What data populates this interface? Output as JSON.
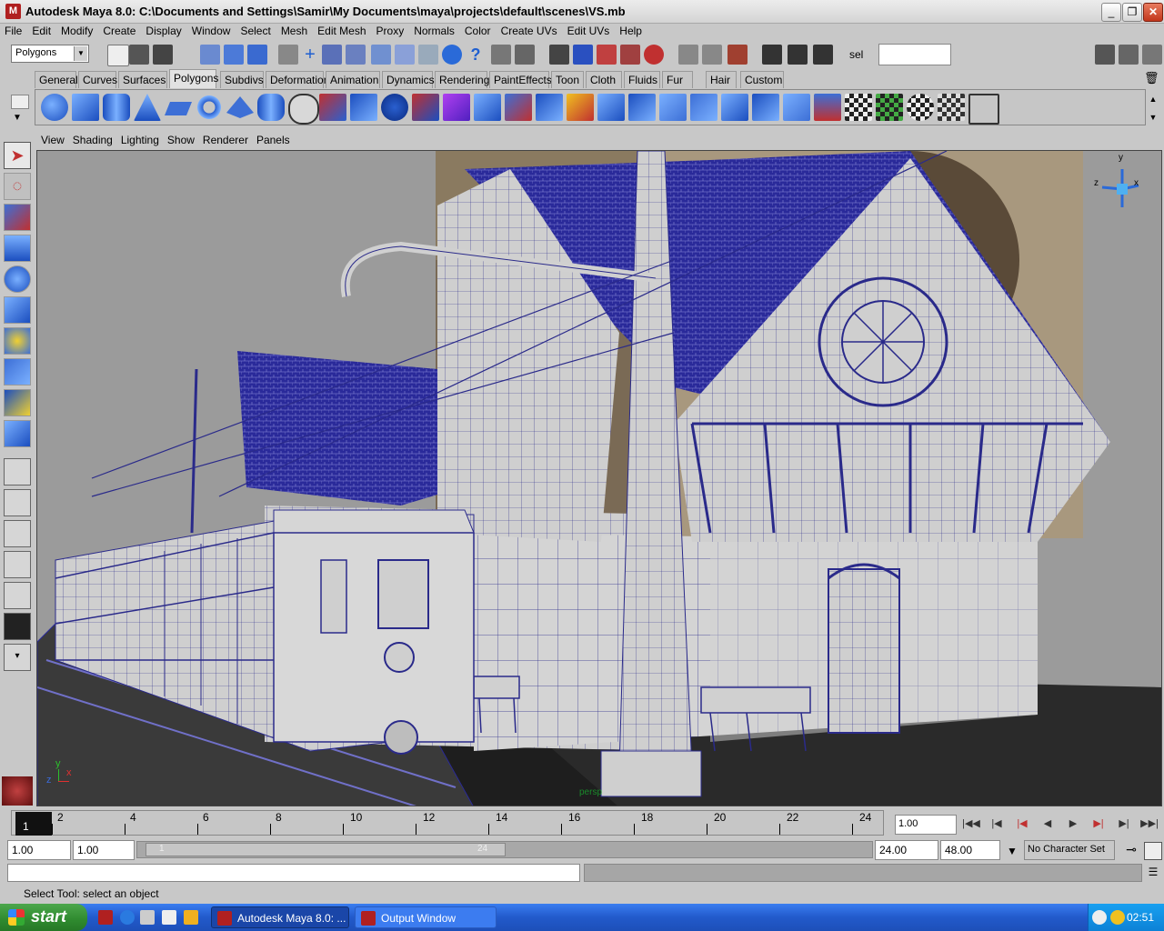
{
  "window": {
    "title": "Autodesk Maya 8.0: C:\\Documents and Settings\\Samir\\My Documents\\maya\\projects\\default\\scenes\\VS.mb",
    "buttons": {
      "minimize": "_",
      "maximize": "❐",
      "close": "✕"
    }
  },
  "menubar": [
    "File",
    "Edit",
    "Modify",
    "Create",
    "Display",
    "Window",
    "Select",
    "Mesh",
    "Edit Mesh",
    "Proxy",
    "Normals",
    "Color",
    "Create UVs",
    "Edit UVs",
    "Help"
  ],
  "statusline": {
    "mode": "Polygons",
    "sel_label": "sel",
    "sel_value": ""
  },
  "shelf": {
    "tabs": [
      "General",
      "Curves",
      "Surfaces",
      "Polygons",
      "Subdivs",
      "Deformation",
      "Animation",
      "Dynamics",
      "Rendering",
      "PaintEffects",
      "Toon",
      "Cloth",
      "Fluids",
      "Fur",
      "Hair",
      "Custom"
    ],
    "active_tab": "Polygons"
  },
  "viewport": {
    "menu": [
      "View",
      "Shading",
      "Lighting",
      "Show",
      "Renderer",
      "Panels"
    ],
    "camera_label": "persp",
    "axis": {
      "x": "x",
      "y": "y",
      "z": "z"
    }
  },
  "timeline": {
    "current_frame": "1",
    "labels": [
      "2",
      "4",
      "6",
      "8",
      "10",
      "12",
      "14",
      "16",
      "18",
      "20",
      "22",
      "24"
    ],
    "current_time": "1.00"
  },
  "range": {
    "start_time": "1.00",
    "playback_start": "1.00",
    "slider_start": "1",
    "slider_end": "24",
    "playback_end": "24.00",
    "end_time": "48.00",
    "character_set": "No Character Set"
  },
  "helpline": {
    "text": "Select Tool: select an object"
  },
  "taskbar": {
    "start_label": "start",
    "tasks": [
      "Autodesk Maya 8.0: ...",
      "Output Window"
    ],
    "clock": "02:51"
  },
  "colors": {
    "viewport_bg": "#9a9a9a",
    "wire": "#1a1a8c",
    "taskbar": "#225acb"
  }
}
